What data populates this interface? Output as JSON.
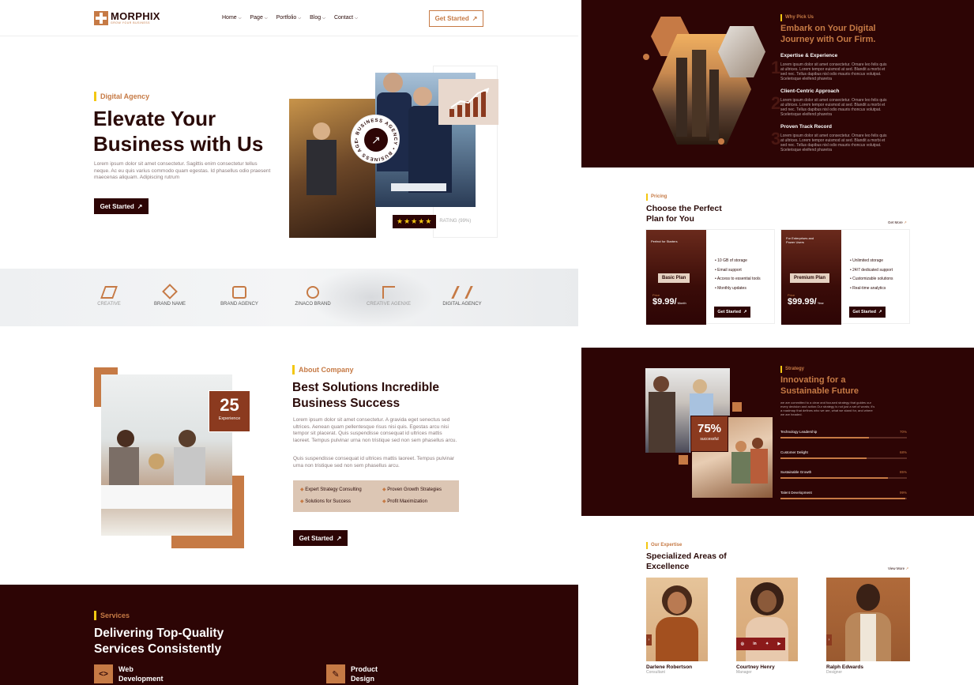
{
  "header": {
    "logo_text": "MORPHIX",
    "logo_sub": "GROW YOUR BUSINESS",
    "nav": [
      {
        "label": "Home"
      },
      {
        "label": "Page"
      },
      {
        "label": "Portfolio"
      },
      {
        "label": "Blog"
      },
      {
        "label": "Contact"
      }
    ],
    "cta": "Get Started"
  },
  "hero": {
    "tag": "Digital Agency",
    "title_line1": "Elevate Your",
    "title_line2": "Business with Us",
    "text": "Lorem ipsum dolor sit amet consectetur. Sagittis enim consectetur tellus neque. Ac eu quis varius commodo quam egestas. Id phasellus odio praesent maecenas aliquam. Adipiscing rutrum",
    "button": "Get Started",
    "badge_text": "• BUSINESS AGENCY • BUSINESS AGENCY",
    "rating_label": "RATING (99%)",
    "stars": "★★★★★"
  },
  "brands": [
    {
      "name": "CREATIVE"
    },
    {
      "name": "BRAND NAME"
    },
    {
      "name": "BRAND AGENCY"
    },
    {
      "name": "ZINACO BRAND"
    },
    {
      "name": "CREATIVE AGENXE"
    },
    {
      "name": "DIGITAL AGENCY"
    }
  ],
  "about": {
    "tag": "About Company",
    "title_line1": "Best Solutions Incredible",
    "title_line2": "Business Success",
    "para1": "Lorem ipsum dolor sit amet consectetur. A gravida eget senectus sed ultrices. Aenean quam pellentesque risus nisi quis. Egestas arcu nisi tempor sit placerat. Quis suspendisse consequat id ultrices mattis laoreet. Tempus pulvinar urna non tristique sed non sem phasellus arcu.",
    "para2": "Quis suspendisse consequat id ultrices mattis laoreet. Tempus pulvinar urna non tristique sed non sem phasellus arcu.",
    "experience_number": "25",
    "experience_label": "Experience",
    "features": [
      "Expert Strategy Consulting",
      "Proven Growth Strategies",
      "Solutions for Success",
      "Profit Maximization"
    ],
    "button": "Get Started"
  },
  "services": {
    "tag": "Services",
    "title_line1": "Delivering Top-Quality",
    "title_line2": "Services Consistently",
    "items": [
      {
        "line1": "Web",
        "line2": "Development"
      },
      {
        "line1": "Product",
        "line2": "Design"
      }
    ]
  },
  "why": {
    "tag": "Why Pick Us",
    "title_line1": "Embark on Your Digital",
    "title_line2": "Journey with Our Firm.",
    "items": [
      {
        "number": "1",
        "title": "Expertise & Experience",
        "text": "Lorem ipsum dolor sit amet consectetur. Ornare leo felis quis at ultrices. Lorem tempor euismod at sed. Blandit a morbi et sed nec. Tellus dapibus nisl odio mauris rhoncus volutpat. Scelerisque eleifend pharetra"
      },
      {
        "number": "2",
        "title": "Client-Centric Approach",
        "text": "Lorem ipsum dolor sit amet consectetur. Ornare leo felis quis at ultrices. Lorem tempor euismod at sed. Blandit a morbi et sed nec. Tellus dapibus nisl odio mauris rhoncus volutpat. Scelerisque eleifend pharetra"
      },
      {
        "number": "3",
        "title": "Proven Track Record",
        "text": "Lorem ipsum dolor sit amet consectetur. Ornare leo felis quis at ultrices. Lorem tempor euismod at sed. Blandit a morbi et sed nec. Tellus dapibus nisl odio mauris rhoncus volutpat. Scelerisque eleifend pharetra"
      }
    ]
  },
  "pricing": {
    "tag": "Pricing",
    "title_line1": "Choose the Perfect",
    "title_line2": "Plan for You",
    "more": "Get More",
    "plans": [
      {
        "kicker": "Perfect for Starters",
        "name": "Basic Plan",
        "price_label": "Price",
        "price": "$9.99/",
        "period": "Month",
        "features": [
          "10 GB of storage",
          "Email support",
          "Access to essential tools",
          "Monthly updates"
        ],
        "button": "Get Started"
      },
      {
        "kicker": "For Enterprises and Power Users",
        "name": "Premium Plan",
        "price_label": "Price",
        "price": "$99.99/",
        "period": "Year",
        "features": [
          "Unlimited storage",
          "24/7 dedicated support",
          "Customizable solutions",
          "Real-time analytics"
        ],
        "button": "Get Started"
      }
    ]
  },
  "strategy": {
    "tag": "Strategy",
    "title_line1": "Innovating for a",
    "title_line2": "Sustainable Future",
    "text": "we are committed to a clear and focused strategy that guides our every decision and action.Our strategy is not just a set of words; it's a roadmap that defines who we are, what we stand for, and where we are headed.",
    "success_number": "75%",
    "success_label": "successful",
    "bars": [
      {
        "label": "Technology Leadership",
        "value": 70,
        "display": "70%"
      },
      {
        "label": "Customer Delight",
        "value": 68,
        "display": "68%"
      },
      {
        "label": "Sustainable Growth",
        "value": 85,
        "display": "85%"
      },
      {
        "label": "Talent Development",
        "value": 99,
        "display": "99%"
      }
    ]
  },
  "expertise": {
    "tag": "Our Expertise",
    "title_line1": "Specialized Areas of",
    "title_line2": "Excellence",
    "more": "View More",
    "team": [
      {
        "name": "Darlene Robertson",
        "role": "Consultant"
      },
      {
        "name": "Courtney Henry",
        "role": "Manager"
      },
      {
        "name": "Ralph Edwards",
        "role": "Designer"
      }
    ]
  },
  "colors": {
    "maroon": "#2d0505",
    "accent": "#c67a45",
    "yellow": "#f3c712"
  }
}
